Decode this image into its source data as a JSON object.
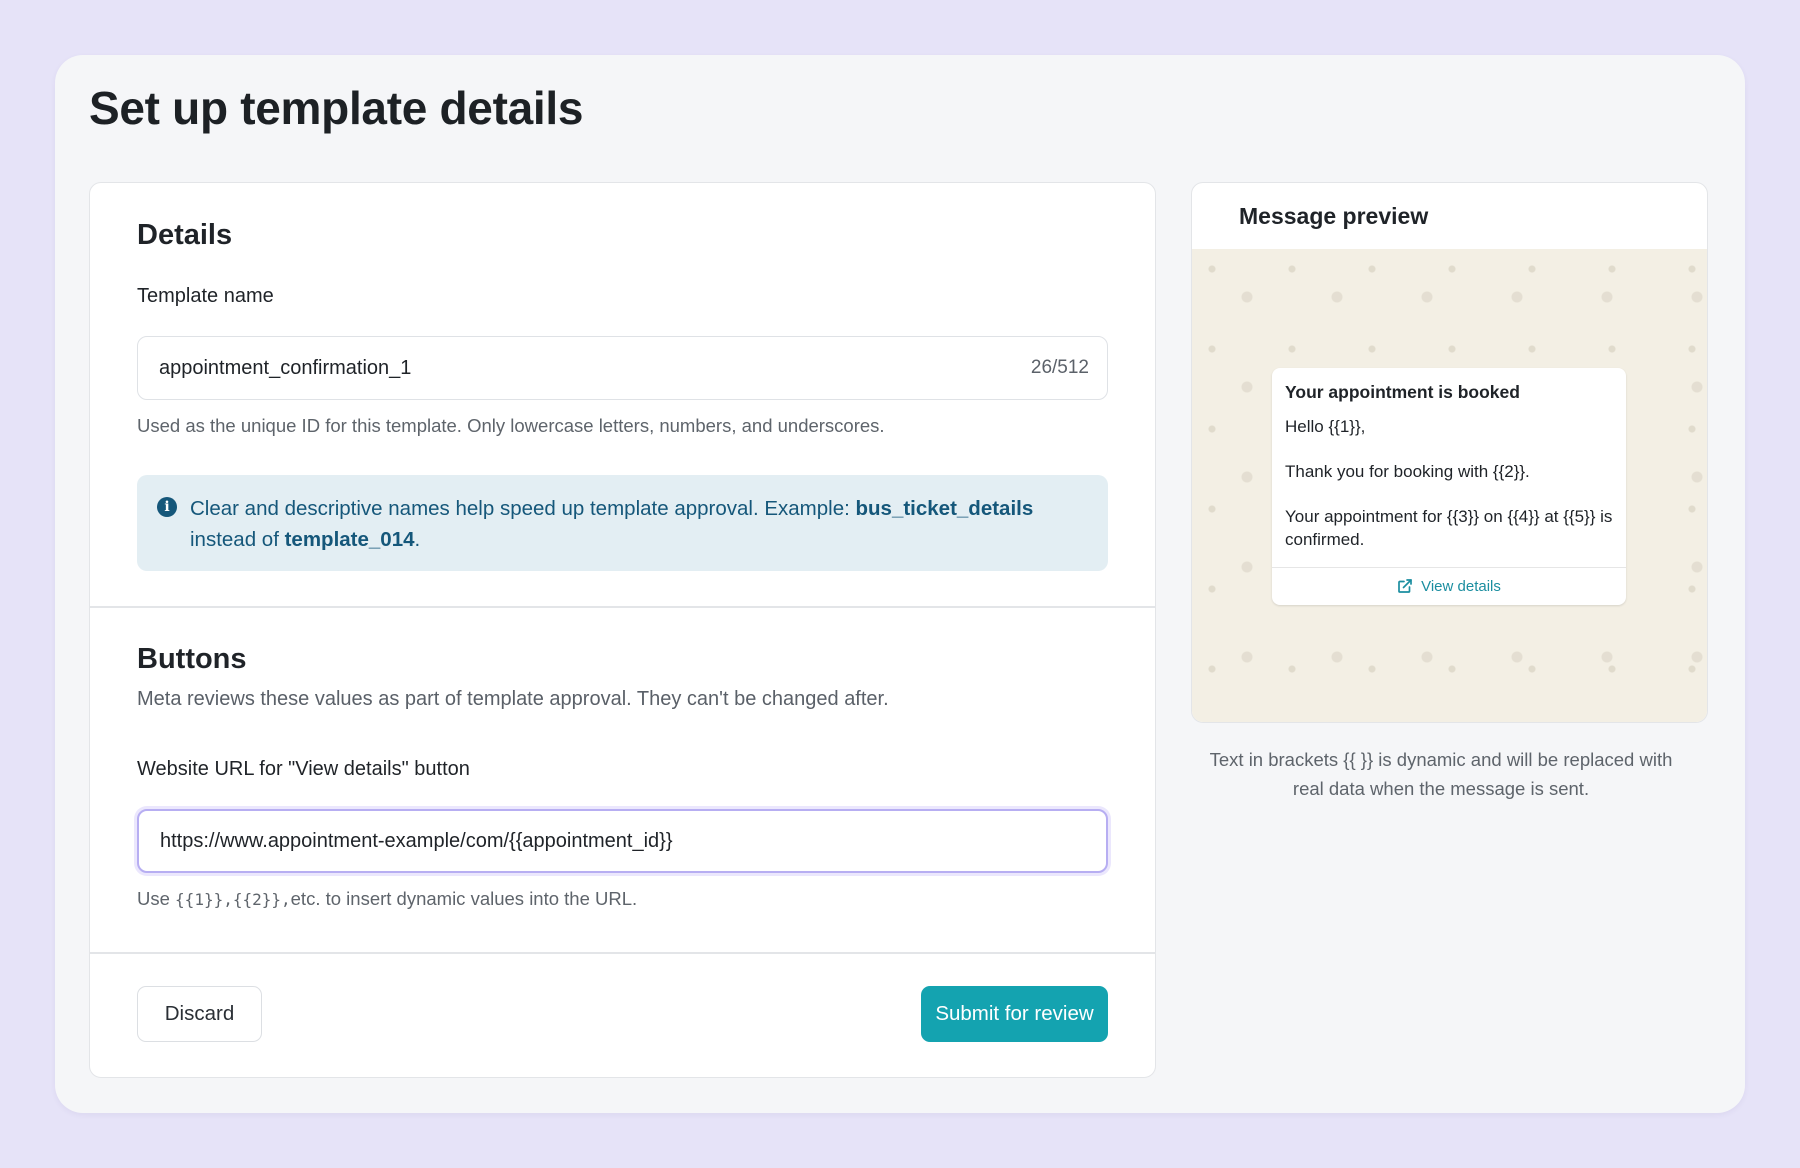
{
  "page": {
    "title": "Set up template details"
  },
  "details": {
    "title": "Details",
    "template_name_label": "Template name",
    "template_name_value": "appointment_confirmation_1",
    "template_name_counter": "26/512",
    "template_name_help": "Used as the unique ID for this template. Only lowercase letters, numbers, and underscores.",
    "info": {
      "text_before": "Clear and descriptive names help speed up template approval. Example: ",
      "example_good": "bus_ticket_details",
      "text_middle": " instead of ",
      "example_bad": "template_014",
      "text_after": "."
    }
  },
  "buttons_section": {
    "title": "Buttons",
    "description": "Meta reviews these values as part of template approval. They can't be changed after.",
    "url_label": "Website URL for \"View details\" button",
    "url_value": "https://www.appointment-example/com/{{appointment_id}}",
    "url_help_prefix": "Use ",
    "url_help_code": "{{1}},{{2}},",
    "url_help_suffix": "etc. to insert dynamic values into the URL."
  },
  "footer": {
    "discard_label": "Discard",
    "submit_label": "Submit for review"
  },
  "preview": {
    "title": "Message preview",
    "bubble_title": "Your appointment is booked",
    "bubble_body": "Hello {{1}},\n\nThank you for booking with {{2}}.\n\nYour appointment for {{3}} on {{4}} at {{5}} is confirmed.",
    "link_label": "View details",
    "link_icon": "external-link-icon",
    "note": "Text in brackets {{ }} is dynamic and will be replaced with real data when the message is sent."
  },
  "colors": {
    "primary": "#14a3b0",
    "info_text": "#15577a",
    "info_bg": "#e3eef3",
    "focus_ring": "#b7aef2",
    "page_bg": "#e6e3f8"
  }
}
